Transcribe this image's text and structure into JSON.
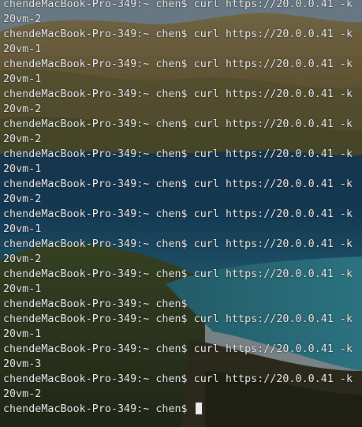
{
  "terminal": {
    "lines": [
      "chendeMacBook-Pro-349:~ chen$ curl https://20.0.0.41 -k",
      "20vm-2",
      "chendeMacBook-Pro-349:~ chen$ curl https://20.0.0.41 -k",
      "20vm-1",
      "chendeMacBook-Pro-349:~ chen$ curl https://20.0.0.41 -k",
      "20vm-1",
      "chendeMacBook-Pro-349:~ chen$ curl https://20.0.0.41 -k",
      "20vm-2",
      "chendeMacBook-Pro-349:~ chen$ curl https://20.0.0.41 -k",
      "20vm-2",
      "chendeMacBook-Pro-349:~ chen$ curl https://20.0.0.41 -k",
      "20vm-1",
      "chendeMacBook-Pro-349:~ chen$ curl https://20.0.0.41 -k",
      "20vm-2",
      "chendeMacBook-Pro-349:~ chen$ curl https://20.0.0.41 -k",
      "20vm-1",
      "chendeMacBook-Pro-349:~ chen$ curl https://20.0.0.41 -k",
      "20vm-2",
      "chendeMacBook-Pro-349:~ chen$ curl https://20.0.0.41 -k",
      "20vm-1",
      "chendeMacBook-Pro-349:~ chen$",
      "chendeMacBook-Pro-349:~ chen$ curl https://20.0.0.41 -k",
      "20vm-1",
      "chendeMacBook-Pro-349:~ chen$ curl https://20.0.0.41 -k",
      "20vm-3",
      "chendeMacBook-Pro-349:~ chen$ curl https://20.0.0.41 -k",
      "20vm-2"
    ],
    "prompt": "chendeMacBook-Pro-349:~ chen$ "
  },
  "theme": {
    "text_color": "#f2f2f2",
    "cursor_color": "#ececec"
  }
}
